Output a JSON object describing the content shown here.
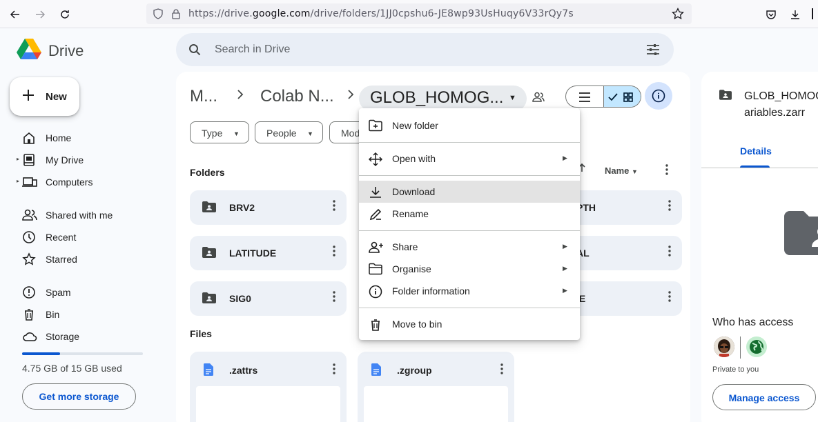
{
  "browser": {
    "url_prefix": "https://drive.",
    "url_domain": "google.com",
    "url_path": "/drive/folders/1JJ0cpshu6-JE8wp93UsHuqy6V33rQy7s"
  },
  "app": {
    "name": "Drive"
  },
  "search": {
    "placeholder": "Search in Drive"
  },
  "new_button": {
    "label": "New"
  },
  "sidebar": {
    "items": [
      {
        "label": "Home"
      },
      {
        "label": "My Drive"
      },
      {
        "label": "Computers"
      },
      {
        "label": "Shared with me"
      },
      {
        "label": "Recent"
      },
      {
        "label": "Starred"
      },
      {
        "label": "Spam"
      },
      {
        "label": "Bin"
      },
      {
        "label": "Storage"
      }
    ],
    "storage_text": "4.75 GB of 15 GB used",
    "storage_used_fraction": 0.317,
    "get_storage": "Get more storage"
  },
  "breadcrumb": {
    "items": [
      "M...",
      "Colab N..."
    ],
    "current": "GLOB_HOMOG..."
  },
  "filters": {
    "chips": [
      "Type",
      "People",
      "Mod"
    ]
  },
  "sections": {
    "folders": "Folders",
    "files": "Files",
    "sort": "Name"
  },
  "folders": [
    {
      "name": "BRV2"
    },
    {
      "name": "LATITUDE"
    },
    {
      "name": "SIG0"
    },
    {
      "name": "PTH"
    },
    {
      "name": "AL"
    },
    {
      "name": "IE"
    }
  ],
  "files": [
    {
      "name": ".zattrs"
    },
    {
      "name": ".zgroup"
    }
  ],
  "context_menu": {
    "items": [
      {
        "label": "New folder"
      },
      {
        "label": "Open with"
      },
      {
        "label": "Download"
      },
      {
        "label": "Rename"
      },
      {
        "label": "Share"
      },
      {
        "label": "Organise"
      },
      {
        "label": "Folder information"
      },
      {
        "label": "Move to bin"
      }
    ]
  },
  "details": {
    "title_line1": "GLOB_HOMOG",
    "title_line2": "ariables.zarr",
    "tab": "Details",
    "who_has_access": "Who has access",
    "private": "Private to you",
    "manage": "Manage access"
  },
  "colors": {
    "accent": "#0b57d0",
    "highlight": "#c2e7ff"
  }
}
